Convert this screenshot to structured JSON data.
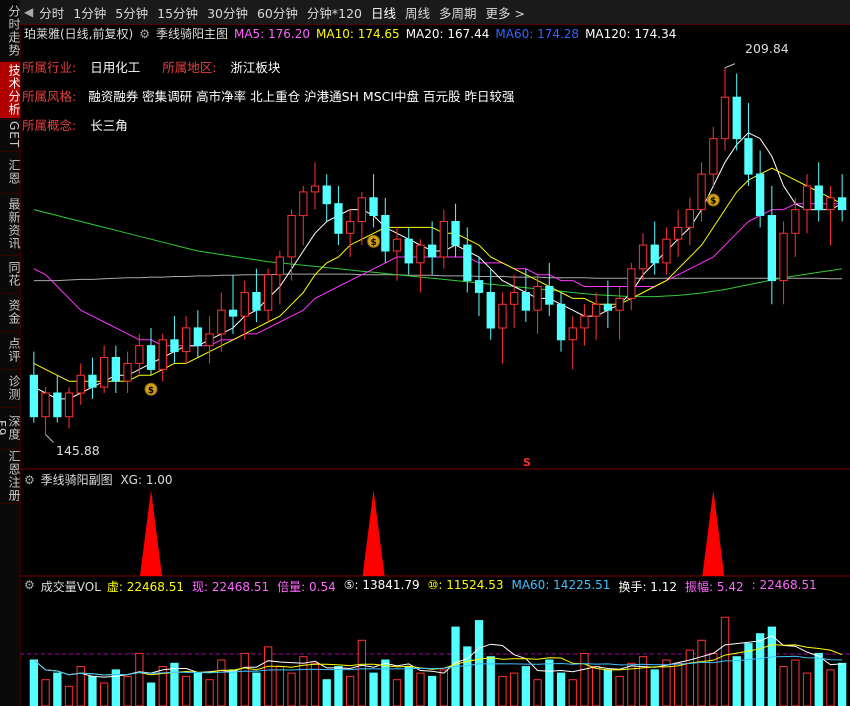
{
  "sidebar": {
    "items": [
      {
        "label": "分时走势",
        "active": false
      },
      {
        "label": "技术分析",
        "active": true
      },
      {
        "label": "GET",
        "active": false
      },
      {
        "label": "汇恩",
        "active": false
      },
      {
        "label": "最新资讯",
        "active": false
      },
      {
        "label": "同花",
        "active": false
      },
      {
        "label": "资金",
        "active": false
      },
      {
        "label": "点评",
        "active": false
      },
      {
        "label": "诊测",
        "active": false
      },
      {
        "label": "深度F9",
        "active": false
      },
      {
        "label": "汇恩注册",
        "active": false
      }
    ]
  },
  "toolbar": {
    "periods": [
      {
        "label": "分时",
        "active": false
      },
      {
        "label": "1分钟",
        "active": false
      },
      {
        "label": "5分钟",
        "active": false
      },
      {
        "label": "15分钟",
        "active": false
      },
      {
        "label": "30分钟",
        "active": false
      },
      {
        "label": "60分钟",
        "active": false
      },
      {
        "label": "分钟*120",
        "active": false
      },
      {
        "label": "日线",
        "active": true
      },
      {
        "label": "周线",
        "active": false
      },
      {
        "label": "多周期",
        "active": false
      },
      {
        "label": "更多 >",
        "active": false
      }
    ]
  },
  "main_chart": {
    "stock_title": "珀莱雅(日线,前复权)",
    "indicator_name": "季线骑阳主图",
    "ma": [
      {
        "label": "MA5: 176.20",
        "color": "#ff66ff"
      },
      {
        "label": "MA10: 174.65",
        "color": "#ffff00"
      },
      {
        "label": "MA20: 167.44",
        "color": "#ffffff"
      },
      {
        "label": "MA60: 174.28",
        "color": "#3366ff"
      },
      {
        "label": "MA120: 174.34",
        "color": "#ffffff"
      }
    ],
    "high_label": "209.84",
    "low_label": "145.88",
    "info": [
      {
        "key": "所属行业:",
        "values": [
          "日用化工"
        ],
        "key2": "所属地区:",
        "values2": [
          "浙江板块"
        ]
      },
      {
        "key": "所属风格:",
        "values": [
          "融资融券 密集调研 高市净率 北上重仓 沪港通SH MSCI中盘 百元股 昨日较强"
        ]
      },
      {
        "key": "所属概念:",
        "values": [
          "长三角"
        ]
      }
    ],
    "marker_s": "S",
    "y_range": [
      143,
      214
    ]
  },
  "sub_chart": {
    "title": "季线骑阳副图",
    "xg_label": "XG: 1.00"
  },
  "volume_chart": {
    "title": "成交量VOL",
    "fields": [
      {
        "label": "虚: 22468.51",
        "color": "#ffff00"
      },
      {
        "label": "现: 22468.51",
        "color": "#ff66ff"
      },
      {
        "label": "倍量: 0.54",
        "color": "#ff66ff"
      },
      {
        "label": "⑤: 13841.79",
        "color": "#ffffff"
      },
      {
        "label": "⑩: 11524.53",
        "color": "#ffff00"
      },
      {
        "label": "MA60: 14225.51",
        "color": "#40c0ff"
      },
      {
        "label": "换手: 1.12",
        "color": "#ffffff"
      },
      {
        "label": "振幅: 5.42",
        "color": "#ff66ff"
      },
      {
        "label": ": 22468.51",
        "color": "#ff66ff"
      }
    ]
  },
  "chart_data": {
    "type": "candlestick",
    "title": "珀莱雅(日线,前复权)",
    "colors": {
      "up": "#ff3232",
      "down": "#54ffff",
      "ma5": "#ffffff",
      "ma10": "#ffff00",
      "ma20": "#ff33ff",
      "ma60": "#33cc33",
      "ma120": "#aaaaaa"
    },
    "ohlc": [
      [
        158,
        162,
        150,
        151
      ],
      [
        151,
        156,
        148,
        155
      ],
      [
        155,
        158,
        150,
        151
      ],
      [
        151,
        156,
        149,
        155
      ],
      [
        155,
        160,
        153,
        158
      ],
      [
        158,
        161,
        154,
        156
      ],
      [
        156,
        163,
        155,
        161
      ],
      [
        161,
        163,
        155,
        157
      ],
      [
        157,
        162,
        155,
        160
      ],
      [
        160,
        165,
        158,
        163
      ],
      [
        163,
        166,
        158,
        159
      ],
      [
        159,
        165,
        157,
        164
      ],
      [
        164,
        168,
        160,
        162
      ],
      [
        162,
        168,
        160,
        166
      ],
      [
        166,
        169,
        161,
        163
      ],
      [
        163,
        168,
        160,
        165
      ],
      [
        165,
        172,
        162,
        169
      ],
      [
        169,
        175,
        165,
        168
      ],
      [
        168,
        174,
        164,
        172
      ],
      [
        172,
        176,
        167,
        169
      ],
      [
        169,
        176,
        167,
        175
      ],
      [
        175,
        179,
        170,
        178
      ],
      [
        178,
        186,
        174,
        185
      ],
      [
        185,
        190,
        180,
        189
      ],
      [
        189,
        194,
        186,
        190
      ],
      [
        190,
        192,
        184,
        187
      ],
      [
        187,
        190,
        180,
        182
      ],
      [
        182,
        186,
        178,
        184
      ],
      [
        184,
        189,
        180,
        188
      ],
      [
        188,
        192,
        183,
        185
      ],
      [
        185,
        188,
        177,
        179
      ],
      [
        179,
        183,
        174,
        181
      ],
      [
        181,
        183,
        175,
        177
      ],
      [
        177,
        181,
        172,
        180
      ],
      [
        180,
        184,
        175,
        178
      ],
      [
        178,
        186,
        176,
        184
      ],
      [
        184,
        187,
        178,
        180
      ],
      [
        180,
        183,
        172,
        174
      ],
      [
        174,
        178,
        168,
        172
      ],
      [
        172,
        176,
        164,
        166
      ],
      [
        166,
        172,
        160,
        170
      ],
      [
        170,
        175,
        166,
        172
      ],
      [
        172,
        176,
        167,
        169
      ],
      [
        169,
        175,
        165,
        173
      ],
      [
        173,
        177,
        168,
        170
      ],
      [
        170,
        172,
        162,
        164
      ],
      [
        164,
        168,
        159,
        166
      ],
      [
        166,
        170,
        163,
        168
      ],
      [
        168,
        172,
        164,
        170
      ],
      [
        170,
        174,
        166,
        169
      ],
      [
        169,
        173,
        164,
        171
      ],
      [
        171,
        177,
        169,
        176
      ],
      [
        176,
        182,
        174,
        180
      ],
      [
        180,
        184,
        175,
        177
      ],
      [
        177,
        183,
        175,
        181
      ],
      [
        181,
        186,
        178,
        183
      ],
      [
        183,
        188,
        180,
        186
      ],
      [
        186,
        194,
        184,
        192
      ],
      [
        192,
        200,
        190,
        198
      ],
      [
        198,
        210,
        196,
        205
      ],
      [
        205,
        209,
        196,
        198
      ],
      [
        198,
        204,
        190,
        192
      ],
      [
        192,
        196,
        183,
        185
      ],
      [
        185,
        190,
        170,
        174
      ],
      [
        174,
        184,
        170,
        182
      ],
      [
        182,
        188,
        178,
        186
      ],
      [
        186,
        192,
        182,
        190
      ],
      [
        190,
        194,
        184,
        186
      ],
      [
        186,
        190,
        180,
        188
      ],
      [
        188,
        192,
        184,
        186
      ]
    ],
    "ma5": [
      156,
      155,
      154,
      154,
      155,
      156,
      157,
      158,
      158,
      159,
      160,
      161,
      162,
      163,
      163,
      164,
      165,
      166,
      168,
      169,
      171,
      173,
      176,
      179,
      182,
      184,
      185,
      186,
      186,
      185,
      183,
      182,
      181,
      180,
      179,
      179,
      180,
      179,
      178,
      176,
      174,
      173,
      172,
      171,
      171,
      170,
      169,
      168,
      168,
      169,
      170,
      172,
      175,
      177,
      179,
      181,
      183,
      186,
      190,
      194,
      197,
      199,
      198,
      195,
      190,
      187,
      186,
      186,
      186,
      187
    ],
    "ma10": [
      160,
      159,
      158,
      157,
      157,
      157,
      157,
      157,
      157,
      158,
      158,
      159,
      160,
      160,
      161,
      162,
      163,
      164,
      165,
      166,
      167,
      168,
      170,
      172,
      175,
      177,
      178,
      180,
      181,
      182,
      183,
      183,
      183,
      183,
      183,
      182,
      182,
      181,
      180,
      178,
      177,
      176,
      175,
      174,
      173,
      172,
      171,
      171,
      170,
      170,
      170,
      171,
      172,
      173,
      174,
      176,
      178,
      180,
      183,
      186,
      189,
      191,
      192,
      193,
      192,
      191,
      190,
      189,
      188,
      187
    ],
    "ma20": [
      176,
      175,
      173,
      171,
      169,
      168,
      167,
      166,
      165,
      164,
      164,
      163,
      163,
      163,
      163,
      163,
      164,
      164,
      165,
      165,
      166,
      167,
      168,
      169,
      171,
      172,
      173,
      174,
      175,
      176,
      177,
      178,
      178,
      178,
      178,
      178,
      178,
      178,
      177,
      177,
      177,
      176,
      176,
      175,
      175,
      174,
      174,
      173,
      173,
      173,
      173,
      173,
      173,
      173,
      174,
      175,
      176,
      177,
      178,
      180,
      182,
      184,
      185,
      186,
      186,
      187,
      187,
      187,
      187,
      187
    ],
    "ma60": [
      186,
      185.5,
      185,
      184.5,
      184,
      183.5,
      183,
      182.5,
      182,
      181.5,
      181,
      180.5,
      180,
      179.5,
      179,
      178.7,
      178.4,
      178.1,
      177.8,
      177.5,
      177.2,
      177,
      176.8,
      176.6,
      176.4,
      176.2,
      176,
      175.8,
      175.6,
      175.4,
      175.2,
      175,
      174.8,
      174.6,
      174.4,
      174.2,
      174,
      173.8,
      173.6,
      173.4,
      173.2,
      173,
      172.8,
      172.6,
      172.4,
      172.2,
      172,
      171.8,
      171.6,
      171.5,
      171.4,
      171.3,
      171.3,
      171.3,
      171.4,
      171.5,
      171.7,
      171.9,
      172.2,
      172.5,
      172.9,
      173.3,
      173.7,
      174.1,
      174.5,
      174.8,
      175.1,
      175.4,
      175.7,
      176
    ],
    "ma120": [
      174,
      174,
      174,
      174.1,
      174.2,
      174.2,
      174.3,
      174.4,
      174.5,
      174.5,
      174.6,
      174.6,
      174.7,
      174.7,
      174.8,
      174.8,
      174.9,
      174.9,
      175,
      175,
      175,
      175.1,
      175.1,
      175.1,
      175.1,
      175.1,
      175.1,
      175.1,
      175,
      175,
      175,
      175,
      174.9,
      174.9,
      174.9,
      174.8,
      174.8,
      174.8,
      174.7,
      174.7,
      174.7,
      174.6,
      174.6,
      174.6,
      174.5,
      174.5,
      174.5,
      174.5,
      174.4,
      174.4,
      174.4,
      174.4,
      174.4,
      174.4,
      174.4,
      174.4,
      174.4,
      174.4,
      174.4,
      174.4,
      174.4,
      174.4,
      174.4,
      174.4,
      174.4,
      174.4,
      174.4,
      174.4,
      174.3,
      174.3
    ],
    "volume": [
      14,
      8,
      10,
      6,
      12,
      9,
      7,
      11,
      9,
      16,
      7,
      12,
      13,
      9,
      10,
      8,
      14,
      11,
      16,
      10,
      18,
      12,
      10,
      15,
      13,
      8,
      12,
      9,
      20,
      10,
      14,
      8,
      12,
      10,
      9,
      11,
      24,
      18,
      26,
      15,
      9,
      10,
      12,
      8,
      14,
      10,
      8,
      16,
      12,
      11,
      9,
      13,
      15,
      11,
      14,
      13,
      17,
      20,
      16,
      27,
      15,
      19,
      22,
      24,
      12,
      14,
      10,
      16,
      11,
      13
    ],
    "xg_signals": [
      10,
      29,
      58
    ]
  }
}
